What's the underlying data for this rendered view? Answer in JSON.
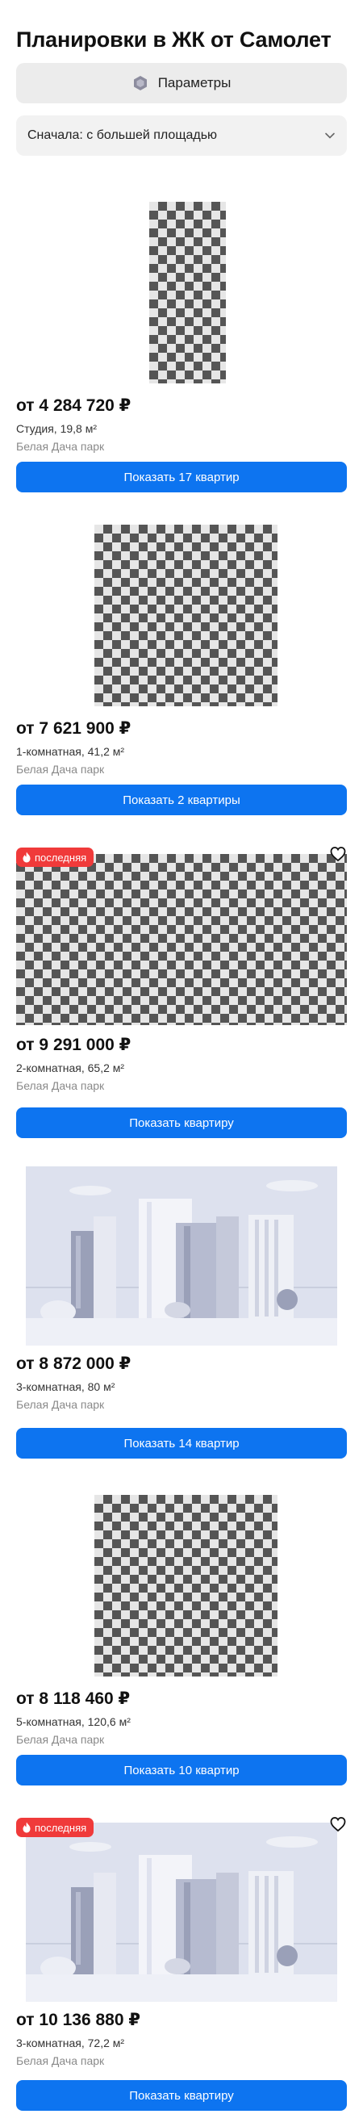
{
  "page": {
    "title": "Планировки в ЖК от Самолет"
  },
  "filters": {
    "params_label": "Параметры",
    "sort_label": "Сначала: с большей площадью"
  },
  "badge_label": "последняя",
  "cards": [
    {
      "price": "от 4 284 720 ₽",
      "rooms": "Студия, 19,8 м²",
      "complex": "Белая Дача парк",
      "button": "Показать 17 квартир"
    },
    {
      "price": "от 7 621 900 ₽",
      "rooms": "1-комнатная, 41,2 м²",
      "complex": "Белая Дача парк",
      "button": "Показать 2 квартиры"
    },
    {
      "price": "от 9 291 000 ₽",
      "rooms": "2-комнатная, 65,2 м²",
      "complex": "Белая Дача парк",
      "button": "Показать квартиру"
    },
    {
      "price": "от 8 872 000 ₽",
      "rooms": "3-комнатная, 80 м²",
      "complex": "Белая Дача парк",
      "button": "Показать 14 квартир"
    },
    {
      "price": "от 8 118 460 ₽",
      "rooms": "5-комнатная, 120,6 м²",
      "complex": "Белая Дача парк",
      "button": "Показать 10 квартир"
    },
    {
      "price": "от 10 136 880 ₽",
      "rooms": "3-комнатная, 72,2 м²",
      "complex": "Белая Дача парк",
      "button": "Показать квартиру"
    }
  ],
  "colors": {
    "accent": "#0d74f0",
    "badge": "#f03a3a",
    "params_bg": "#ececec",
    "select_bg": "#f2f2f2"
  },
  "icons": {
    "params": "hexagon-icon",
    "sort": "chevron-down-icon",
    "badge": "fire-icon",
    "favorite": "heart-icon"
  }
}
